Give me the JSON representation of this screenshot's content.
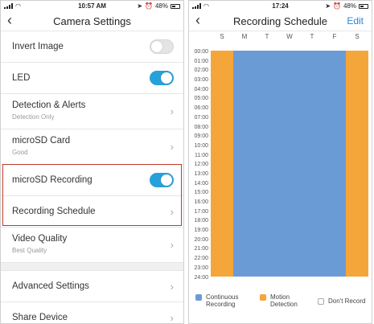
{
  "left": {
    "status": {
      "time": "10:57 AM",
      "battery": "48%"
    },
    "nav": {
      "back": "‹",
      "title": "Camera Settings"
    },
    "rows": {
      "invert": {
        "label": "Invert Image"
      },
      "led": {
        "label": "LED"
      },
      "detection": {
        "label": "Detection & Alerts",
        "sub": "Detection Only"
      },
      "sdcard": {
        "label": "microSD Card",
        "sub": "Good"
      },
      "sdrec": {
        "label": "microSD Recording"
      },
      "schedule": {
        "label": "Recording Schedule"
      },
      "video": {
        "label": "Video Quality",
        "sub": "Best Quality"
      },
      "advanced": {
        "label": "Advanced Settings"
      },
      "share": {
        "label": "Share Device"
      }
    },
    "chevron": "›"
  },
  "right": {
    "status": {
      "time": "17:24",
      "battery": "48%"
    },
    "nav": {
      "back": "‹",
      "title": "Recording Schedule",
      "edit": "Edit"
    },
    "days": [
      "S",
      "M",
      "T",
      "W",
      "T",
      "F",
      "S"
    ],
    "hours": [
      "00:00",
      "01:00",
      "02:00",
      "03:00",
      "04:00",
      "05:00",
      "06:00",
      "07:00",
      "08:00",
      "09:00",
      "10:00",
      "11:00",
      "12:00",
      "13:00",
      "14:00",
      "15:00",
      "16:00",
      "17:00",
      "18:00",
      "19:00",
      "20:00",
      "21:00",
      "22:00",
      "23:00",
      "24:00"
    ],
    "legend": {
      "continuous_1": "Continuous",
      "continuous_2": "Recording",
      "motion_1": "Motion",
      "motion_2": "Detection",
      "none": "Don't Record"
    },
    "colors": {
      "continuous": "#6b9bd5",
      "motion": "#f5a63a",
      "none": "#ffffff",
      "toggle_on": "#27a1d9",
      "highlight": "#c0392b"
    }
  }
}
